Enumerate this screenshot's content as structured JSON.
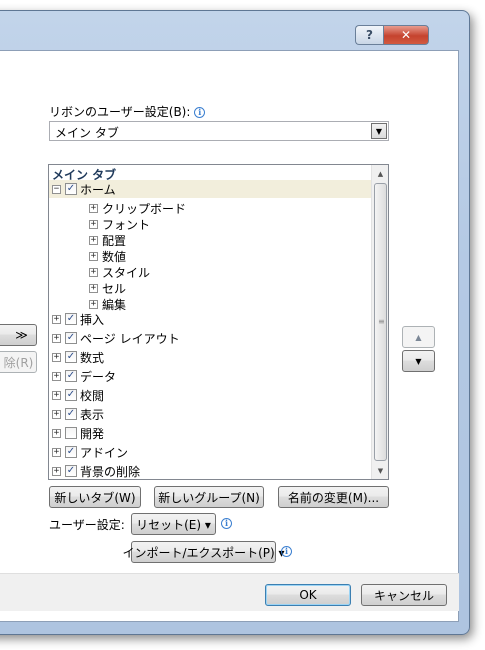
{
  "window": {
    "help_label": "?",
    "close_label": "✕"
  },
  "ribbon": {
    "label": "リボンのユーザー設定(B):",
    "combo_value": "メイン タブ"
  },
  "tree": {
    "header": "メイン タブ",
    "home_label": "ホーム",
    "home_children": [
      "クリップボード",
      "フォント",
      "配置",
      "数値",
      "スタイル",
      "セル",
      "編集"
    ],
    "tabs": [
      {
        "label": "挿入",
        "checked": true
      },
      {
        "label": "ページ レイアウト",
        "checked": true
      },
      {
        "label": "数式",
        "checked": true
      },
      {
        "label": "データ",
        "checked": true
      },
      {
        "label": "校閲",
        "checked": true
      },
      {
        "label": "表示",
        "checked": true
      },
      {
        "label": "開発",
        "checked": false
      },
      {
        "label": "アドイン",
        "checked": true
      },
      {
        "label": "背景の削除",
        "checked": true
      }
    ]
  },
  "left_buttons": {
    "add_label": "≫",
    "remove_label": "除(R)"
  },
  "buttons": {
    "new_tab": "新しいタブ(W)",
    "new_group": "新しいグループ(N)",
    "rename": "名前の変更(M)...",
    "customize_label": "ユーザー設定:",
    "reset": "リセット(E) ▾",
    "import_export": "インポート/エクスポート(P) ▾",
    "ok": "OK",
    "cancel": "キャンセル"
  }
}
